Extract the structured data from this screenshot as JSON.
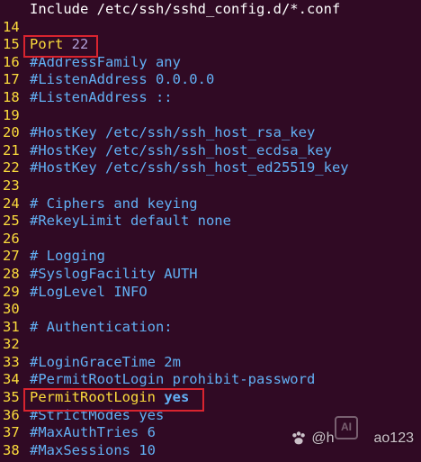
{
  "editor": {
    "lines": [
      {
        "num": "",
        "parts": [
          {
            "t": "Include /etc/ssh/sshd_config.d/*.conf",
            "c": "plain"
          }
        ]
      },
      {
        "num": "14",
        "parts": []
      },
      {
        "num": "15",
        "parts": [
          {
            "t": "Port ",
            "c": "keyword"
          },
          {
            "t": "22",
            "c": "value"
          }
        ]
      },
      {
        "num": "16",
        "parts": [
          {
            "t": "#AddressFamily any",
            "c": "comment"
          }
        ]
      },
      {
        "num": "17",
        "parts": [
          {
            "t": "#ListenAddress 0.0.0.0",
            "c": "comment"
          }
        ]
      },
      {
        "num": "18",
        "parts": [
          {
            "t": "#ListenAddress ::",
            "c": "comment"
          }
        ]
      },
      {
        "num": "19",
        "parts": []
      },
      {
        "num": "20",
        "parts": [
          {
            "t": "#HostKey /etc/ssh/ssh_host_rsa_key",
            "c": "comment"
          }
        ]
      },
      {
        "num": "21",
        "parts": [
          {
            "t": "#HostKey /etc/ssh/ssh_host_ecdsa_key",
            "c": "comment"
          }
        ]
      },
      {
        "num": "22",
        "parts": [
          {
            "t": "#HostKey /etc/ssh/ssh_host_ed25519_key",
            "c": "comment"
          }
        ]
      },
      {
        "num": "23",
        "parts": []
      },
      {
        "num": "24",
        "parts": [
          {
            "t": "# Ciphers and keying",
            "c": "comment"
          }
        ]
      },
      {
        "num": "25",
        "parts": [
          {
            "t": "#RekeyLimit default none",
            "c": "comment"
          }
        ]
      },
      {
        "num": "26",
        "parts": []
      },
      {
        "num": "27",
        "parts": [
          {
            "t": "# Logging",
            "c": "comment"
          }
        ]
      },
      {
        "num": "28",
        "parts": [
          {
            "t": "#SyslogFacility AUTH",
            "c": "comment"
          }
        ]
      },
      {
        "num": "29",
        "parts": [
          {
            "t": "#LogLevel INFO",
            "c": "comment"
          }
        ]
      },
      {
        "num": "30",
        "parts": []
      },
      {
        "num": "31",
        "parts": [
          {
            "t": "# Authentication:",
            "c": "comment"
          }
        ]
      },
      {
        "num": "32",
        "parts": []
      },
      {
        "num": "33",
        "parts": [
          {
            "t": "#LoginGraceTime 2m",
            "c": "comment"
          }
        ]
      },
      {
        "num": "34",
        "parts": [
          {
            "t": "#PermitRootLogin prohibit-password",
            "c": "comment"
          }
        ]
      },
      {
        "num": "35",
        "parts": [
          {
            "t": "PermitRootLogin ",
            "c": "keyword"
          },
          {
            "t": "yes",
            "c": "bold"
          }
        ]
      },
      {
        "num": "36",
        "parts": [
          {
            "t": "#StrictModes yes",
            "c": "comment"
          }
        ]
      },
      {
        "num": "37",
        "parts": [
          {
            "t": "#MaxAuthTries 6",
            "c": "comment"
          }
        ]
      },
      {
        "num": "38",
        "parts": [
          {
            "t": "#MaxSessions 10",
            "c": "comment"
          }
        ]
      }
    ]
  },
  "watermark": {
    "text": "@h",
    "text_tail": "ao123",
    "ai_label": "AI"
  },
  "colors": {
    "background": "#300a24",
    "line_number": "#fcdc3c",
    "comment": "#62b0f4",
    "keyword": "#fcdc3c",
    "value": "#b0a0d8",
    "highlight_box": "#d9242f"
  }
}
